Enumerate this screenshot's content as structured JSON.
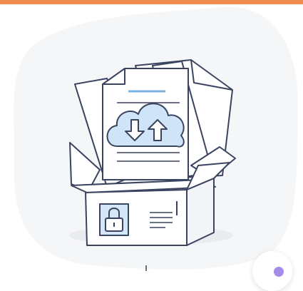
{
  "theme": {
    "accent": "#f08a4f",
    "background_blob": "#f6f7f8",
    "outline": "#3a4460",
    "cloud_fill": "#cfe5f7",
    "lock_fill": "#d6e8f7",
    "badge_dot": "#a58ce8"
  },
  "icons": {
    "illustration": "file-box-cloud-sync-illustration",
    "cloud": "cloud-upload-download-icon",
    "lock": "padlock-icon",
    "badge": "chat-badge-icon"
  }
}
